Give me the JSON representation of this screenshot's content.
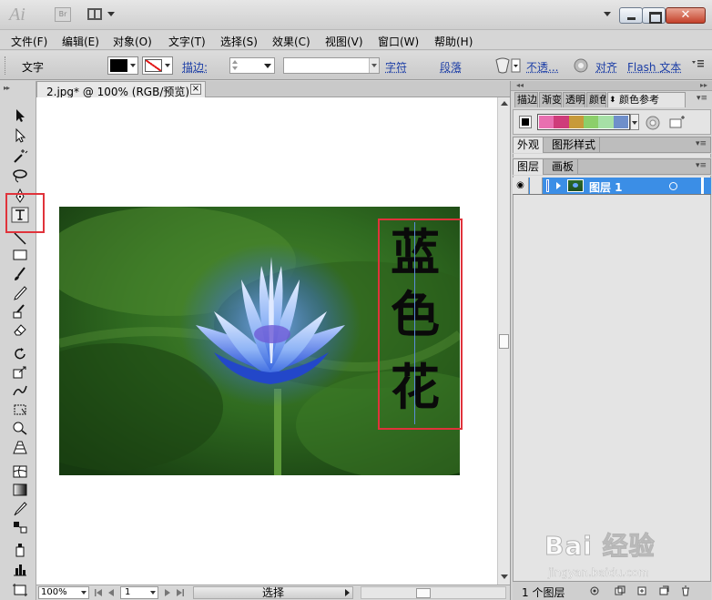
{
  "app": {
    "logo": "Ai",
    "bridge_label": "Br"
  },
  "menubar": {
    "items": [
      "文件(F)",
      "编辑(E)",
      "对象(O)",
      "文字(T)",
      "选择(S)",
      "效果(C)",
      "视图(V)",
      "窗口(W)",
      "帮助(H)"
    ]
  },
  "control_bar": {
    "tool_label": "文字",
    "stroke_label": "描边:",
    "char_link": "字符",
    "para_link": "段落",
    "opacity_link": "不透...",
    "align_link": "对齐",
    "flash_link": "Flash 文本",
    "fill_color": "#000000",
    "stroke_none_color": "#e21a1a"
  },
  "document": {
    "tab_title": "2.jpg* @ 100% (RGB/预览)",
    "close_glyph": "×",
    "text_content": [
      "蓝",
      "色",
      "花"
    ]
  },
  "status_bar": {
    "zoom": "100%",
    "page": "1",
    "status_text": "选择"
  },
  "panels": {
    "top_tabs": [
      "描边",
      "渐变",
      "透明",
      "颜色",
      "颜色参考"
    ],
    "guide_colors": [
      "#e86fb0",
      "#cf3c7a",
      "#c79a3a",
      "#8ccf6a",
      "#a6e0a6",
      "#6f8fca"
    ],
    "appearance_tabs": [
      "外观",
      "图形样式"
    ],
    "layers_tabs": [
      "图层",
      "画板"
    ],
    "layer": {
      "name": "图层 1",
      "eye_glyph": "◉"
    },
    "layer_count": "1 个图层",
    "menu_glyph": "▾≡"
  },
  "watermark": {
    "text": "Bai 经验",
    "url": "jingyan.baidu.com"
  }
}
